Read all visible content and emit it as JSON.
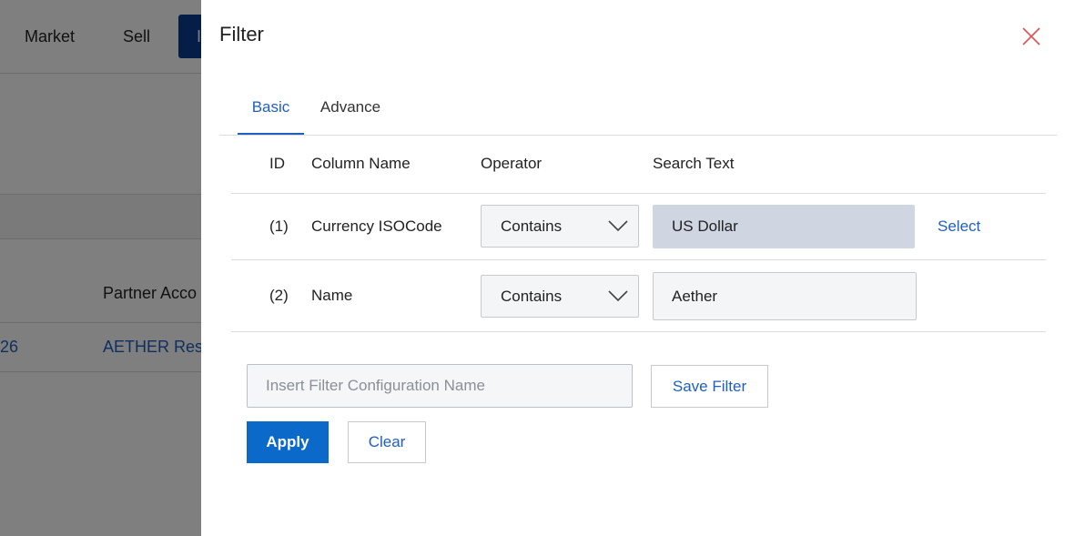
{
  "background": {
    "nav_items": [
      "Market",
      "Sell"
    ],
    "active_nav_label": "I",
    "table_header_partial": "Partner Acco",
    "row_value_partial": "26",
    "row_link_partial": "AETHER Rese"
  },
  "filter": {
    "title": "Filter",
    "tabs": [
      {
        "label": "Basic",
        "active": true
      },
      {
        "label": "Advance",
        "active": false
      }
    ],
    "columns": [
      "ID",
      "Column Name",
      "Operator",
      "Search Text"
    ],
    "rows": [
      {
        "id": "(1)",
        "column_name": "Currency ISOCode",
        "operator": "Contains",
        "search_text": "US Dollar",
        "action": "Select"
      },
      {
        "id": "(2)",
        "column_name": "Name",
        "operator": "Contains",
        "search_text": "Aether"
      }
    ],
    "config_name_placeholder": "Insert Filter Configuration Name",
    "save_filter_label": "Save Filter",
    "apply_label": "Apply",
    "clear_label": "Clear"
  },
  "colors": {
    "accent": "#1e5fbf",
    "apply_button": "#0b6ac9",
    "close_icon": "#d9534f"
  }
}
